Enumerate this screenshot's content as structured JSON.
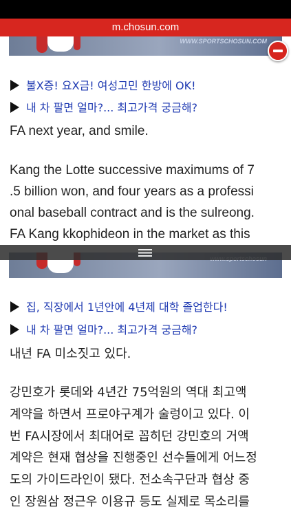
{
  "browser": {
    "url": "m.chosun.com"
  },
  "photo": {
    "watermark": "WWW.SPORTSCHOSUN.COM",
    "watermark_mid": "www.sportschosun"
  },
  "links_top": [
    {
      "text": "불X증! 요X금! 여성고민 한방에 OK!"
    },
    {
      "text": "내 차 팔면 얼마?... 최고가격 궁금해?"
    }
  ],
  "english": {
    "line1": "FA next year, and smile.",
    "para_lines": [
      "Kang the Lotte successive maximums of 7",
      ".5 billion won, and four years as a professi",
      "onal baseball contract and is the sulreong.",
      "FA Kang kkophideon in the market as this"
    ]
  },
  "links_mid": [
    {
      "text": "집, 직장에서 1년안에 4년제 대학 졸업한다!"
    },
    {
      "text": "내 차 팔면 얼마?... 최고가격 궁금해?"
    }
  ],
  "korean": {
    "line1": "내년 FA 미소짓고 있다.",
    "para_lines": [
      "강민호가 롯데와 4년간 75억원의 역대 최고액",
      "계약을 하면서 프로야구계가 술렁이고 있다. 이",
      "번 FA시장에서 최대어로 꼽히던 강민호의 거액",
      "계약은 현재 협상을 진행중인 선수들에게 어느정",
      "도의 가이드라인이 됐다. 전소속구단과 협상 중",
      "인 장원삼 정근우 이용규 등도 실제로 목소리를"
    ]
  }
}
